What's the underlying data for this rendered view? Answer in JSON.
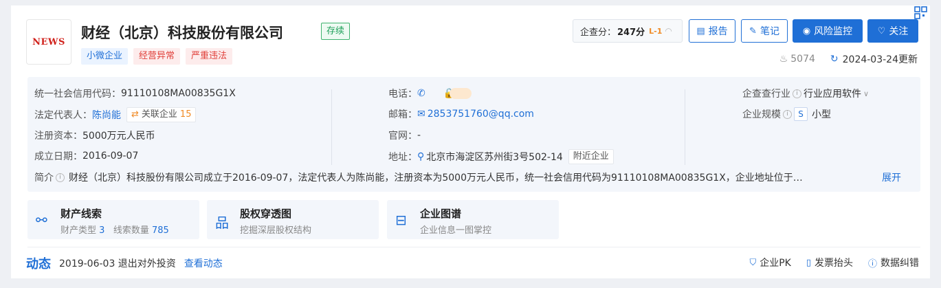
{
  "company": {
    "logo_text": "NEWS",
    "name": "财经（北京）科技股份有限公司",
    "status": "存续",
    "tags": [
      "小微企业",
      "经营异常",
      "严重违法"
    ]
  },
  "header": {
    "score_label": "企查分：",
    "score_value": "247分",
    "score_level": "L-1",
    "buttons": {
      "report": "报告",
      "notes": "笔记",
      "risk": "风险监控",
      "follow": "关注"
    },
    "views": "5074",
    "updated": "2024-03-24更新"
  },
  "info": {
    "credit_code_label": "统一社会信用代码：",
    "credit_code": "91110108MA00835G1X",
    "legal_rep_label": "法定代表人：",
    "legal_rep": "陈尚能",
    "related_label": "关联企业",
    "related_count": "15",
    "capital_label": "注册资本：",
    "capital": "5000万元人民币",
    "founded_label": "成立日期：",
    "founded": "2016-09-07",
    "phone_label": "电话：",
    "email_label": "邮箱：",
    "email": "2853751760@qq.com",
    "website_label": "官网：",
    "website": "-",
    "address_label": "地址：",
    "address": "北京市海淀区苏州街3号502-14",
    "nearby": "附近企业",
    "industry_label": "企查查行业",
    "industry": "行业应用软件",
    "scale_label": "企业规模",
    "scale_badge": "S",
    "scale": "小型",
    "intro_label": "简介",
    "intro": "财经（北京）科技股份有限公司成立于2016-09-07，法定代表人为陈尚能，注册资本为5000万元人民币，统一社会信用代码为91110108MA00835G1X，企业地址位于…",
    "expand": "展开"
  },
  "features": [
    {
      "title": "财产线索",
      "sub1": "财产类型",
      "n1": "3",
      "sub2": "线索数量",
      "n2": "785"
    },
    {
      "title": "股权穿透图",
      "sub": "挖掘深层股权结构"
    },
    {
      "title": "企业图谱",
      "sub": "企业信息一图掌控"
    }
  ],
  "dynamic": {
    "title": "动态",
    "text": "2019-06-03 退出对外投资",
    "link": "查看动态"
  },
  "actions": {
    "pk": "企业PK",
    "invoice": "发票抬头",
    "correction": "数据纠错"
  },
  "colors": {
    "accent": "#1f6fd6",
    "orange": "#f08a24",
    "green": "#20a05a",
    "red": "#e0413b"
  }
}
